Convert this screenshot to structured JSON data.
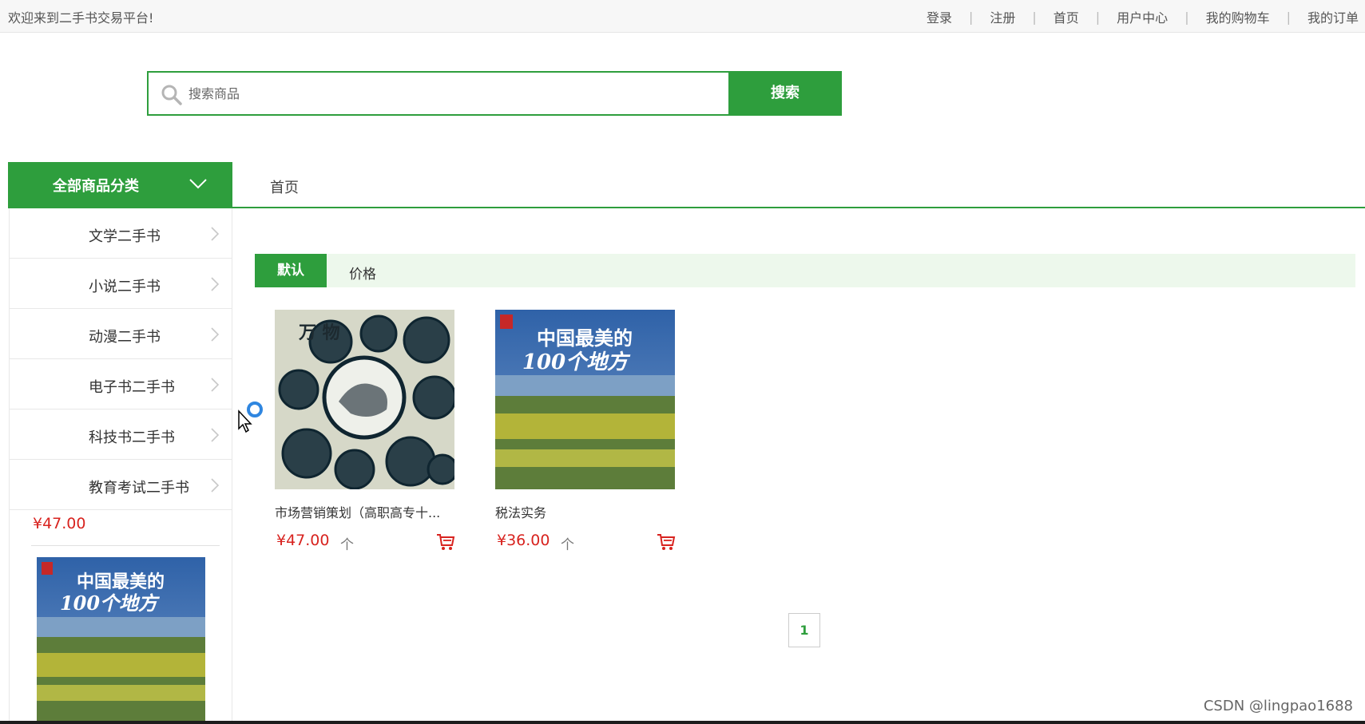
{
  "topbar": {
    "welcome": "欢迎来到二手书交易平台!",
    "links": [
      "登录",
      "注册",
      "首页",
      "用户中心",
      "我的购物车",
      "我的订单"
    ],
    "separator": "|"
  },
  "search": {
    "placeholder": "搜索商品",
    "button": "搜索"
  },
  "nav": {
    "all_categories": "全部商品分类",
    "home": "首页"
  },
  "sidebar": {
    "categories": [
      "文学二手书",
      "小说二手书",
      "动漫二手书",
      "电子书二手书",
      "科技书二手书",
      "教育考试二手书"
    ],
    "featured_price": "¥47.00",
    "featured_cover_title": "中国最美的 100个地方"
  },
  "sort": {
    "default": "默认",
    "price": "价格"
  },
  "products": [
    {
      "title": "市场营销策划（高职高专十...",
      "price": "¥47.00",
      "unit": "个",
      "cover_text": "万 物"
    },
    {
      "title": "税法实务",
      "price": "¥36.00",
      "unit": "个",
      "cover_text": "中国最美的 100个地方"
    }
  ],
  "pagination": {
    "current": "1"
  },
  "watermark": "CSDN @lingpao1688",
  "colors": {
    "accent": "#2e9e3d",
    "price": "#d8231f",
    "sort_bar_bg": "#edf8ec"
  }
}
